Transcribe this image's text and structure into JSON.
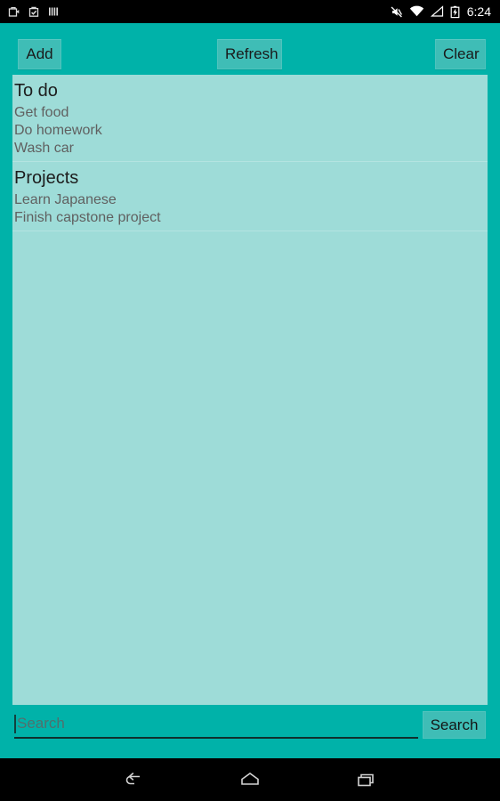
{
  "status_bar": {
    "icons_left": [
      "notification-bag-icon",
      "notification-check-bag-icon",
      "notification-bars-icon"
    ],
    "icons_right": [
      "mute-icon",
      "wifi-icon",
      "signal-icon",
      "battery-charging-icon"
    ],
    "time": "6:24",
    "background": "#000000",
    "foreground": "#ffffff"
  },
  "toolbar": {
    "add_label": "Add",
    "refresh_label": "Refresh",
    "clear_label": "Clear"
  },
  "list": {
    "groups": [
      {
        "header": "To do",
        "items": [
          "Get food",
          "Do homework",
          "Wash car"
        ]
      },
      {
        "header": "Projects",
        "items": [
          "Learn Japanese",
          "Finish capstone project"
        ]
      }
    ]
  },
  "search": {
    "placeholder": "Search",
    "value": "",
    "button_label": "Search"
  },
  "nav_bar": {
    "back_label": "back-icon",
    "home_label": "home-icon",
    "recents_label": "recents-icon"
  },
  "colors": {
    "app_background": "#00b2a9",
    "list_background": "#9edcd8",
    "button_fill": "#3fbdb6",
    "header_text": "#1d1d1d",
    "item_text": "#606060"
  }
}
